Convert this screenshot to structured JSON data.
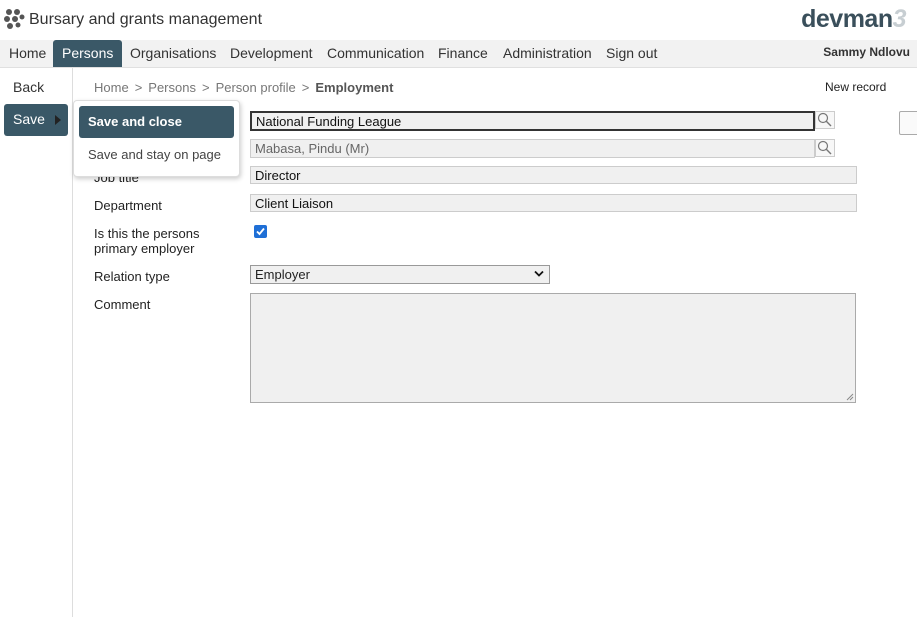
{
  "app": {
    "title": "Bursary and grants management",
    "brand": "devman",
    "brand_suffix": "3"
  },
  "nav": {
    "items": [
      "Home",
      "Persons",
      "Organisations",
      "Development",
      "Communication",
      "Finance",
      "Administration",
      "Sign out"
    ],
    "active": "Persons",
    "user": "Sammy Ndlovu"
  },
  "sidebar": {
    "back_label": "Back",
    "save_label": "Save"
  },
  "save_menu": {
    "save_close": "Save and close",
    "save_stay": "Save and stay on page"
  },
  "breadcrumb": {
    "items": [
      "Home",
      "Persons",
      "Person profile"
    ],
    "current": "Employment"
  },
  "toolbar": {
    "new_record": "New record"
  },
  "form": {
    "organisation_value": "National Funding League",
    "person_value": "Mabasa, Pindu (Mr)",
    "job_title_label": "Job title",
    "job_title_value": "Director",
    "department_label": "Department",
    "department_value": "Client Liaison",
    "primary_employer_label_1": "Is this the persons",
    "primary_employer_label_2": "primary employer",
    "primary_employer_checked": true,
    "relation_type_label": "Relation type",
    "relation_type_value": "Employer",
    "comment_label": "Comment",
    "comment_value": ""
  },
  "colors": {
    "accent": "#3a5867",
    "checkbox": "#1f6fd6"
  }
}
